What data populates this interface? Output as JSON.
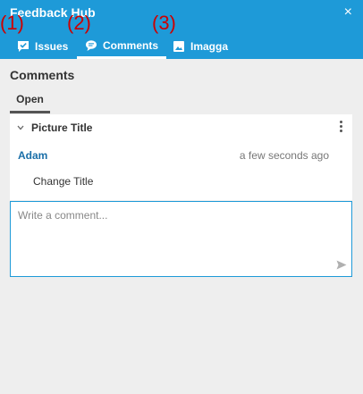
{
  "header": {
    "title": "Feedback Hub",
    "close_glyph": "×",
    "bg_color": "#1e9ad8"
  },
  "tabs": [
    {
      "label": "Issues",
      "icon": "issue-flag-icon",
      "active": false
    },
    {
      "label": "Comments",
      "icon": "comment-bubble-icon",
      "active": true
    },
    {
      "label": "Imagga",
      "icon": "image-icon",
      "active": false
    }
  ],
  "annotations": [
    "(1)",
    "(2)",
    "(3)"
  ],
  "section": {
    "title": "Comments",
    "subtab_label": "Open"
  },
  "thread": {
    "title": "Picture Title",
    "icons": [
      "chevron-down-icon",
      "more-vert-icon"
    ],
    "comment": {
      "author": "Adam",
      "time": "a few seconds ago",
      "text": "Change Title"
    }
  },
  "composer": {
    "placeholder": "Write a comment...",
    "icon": "send-icon"
  }
}
